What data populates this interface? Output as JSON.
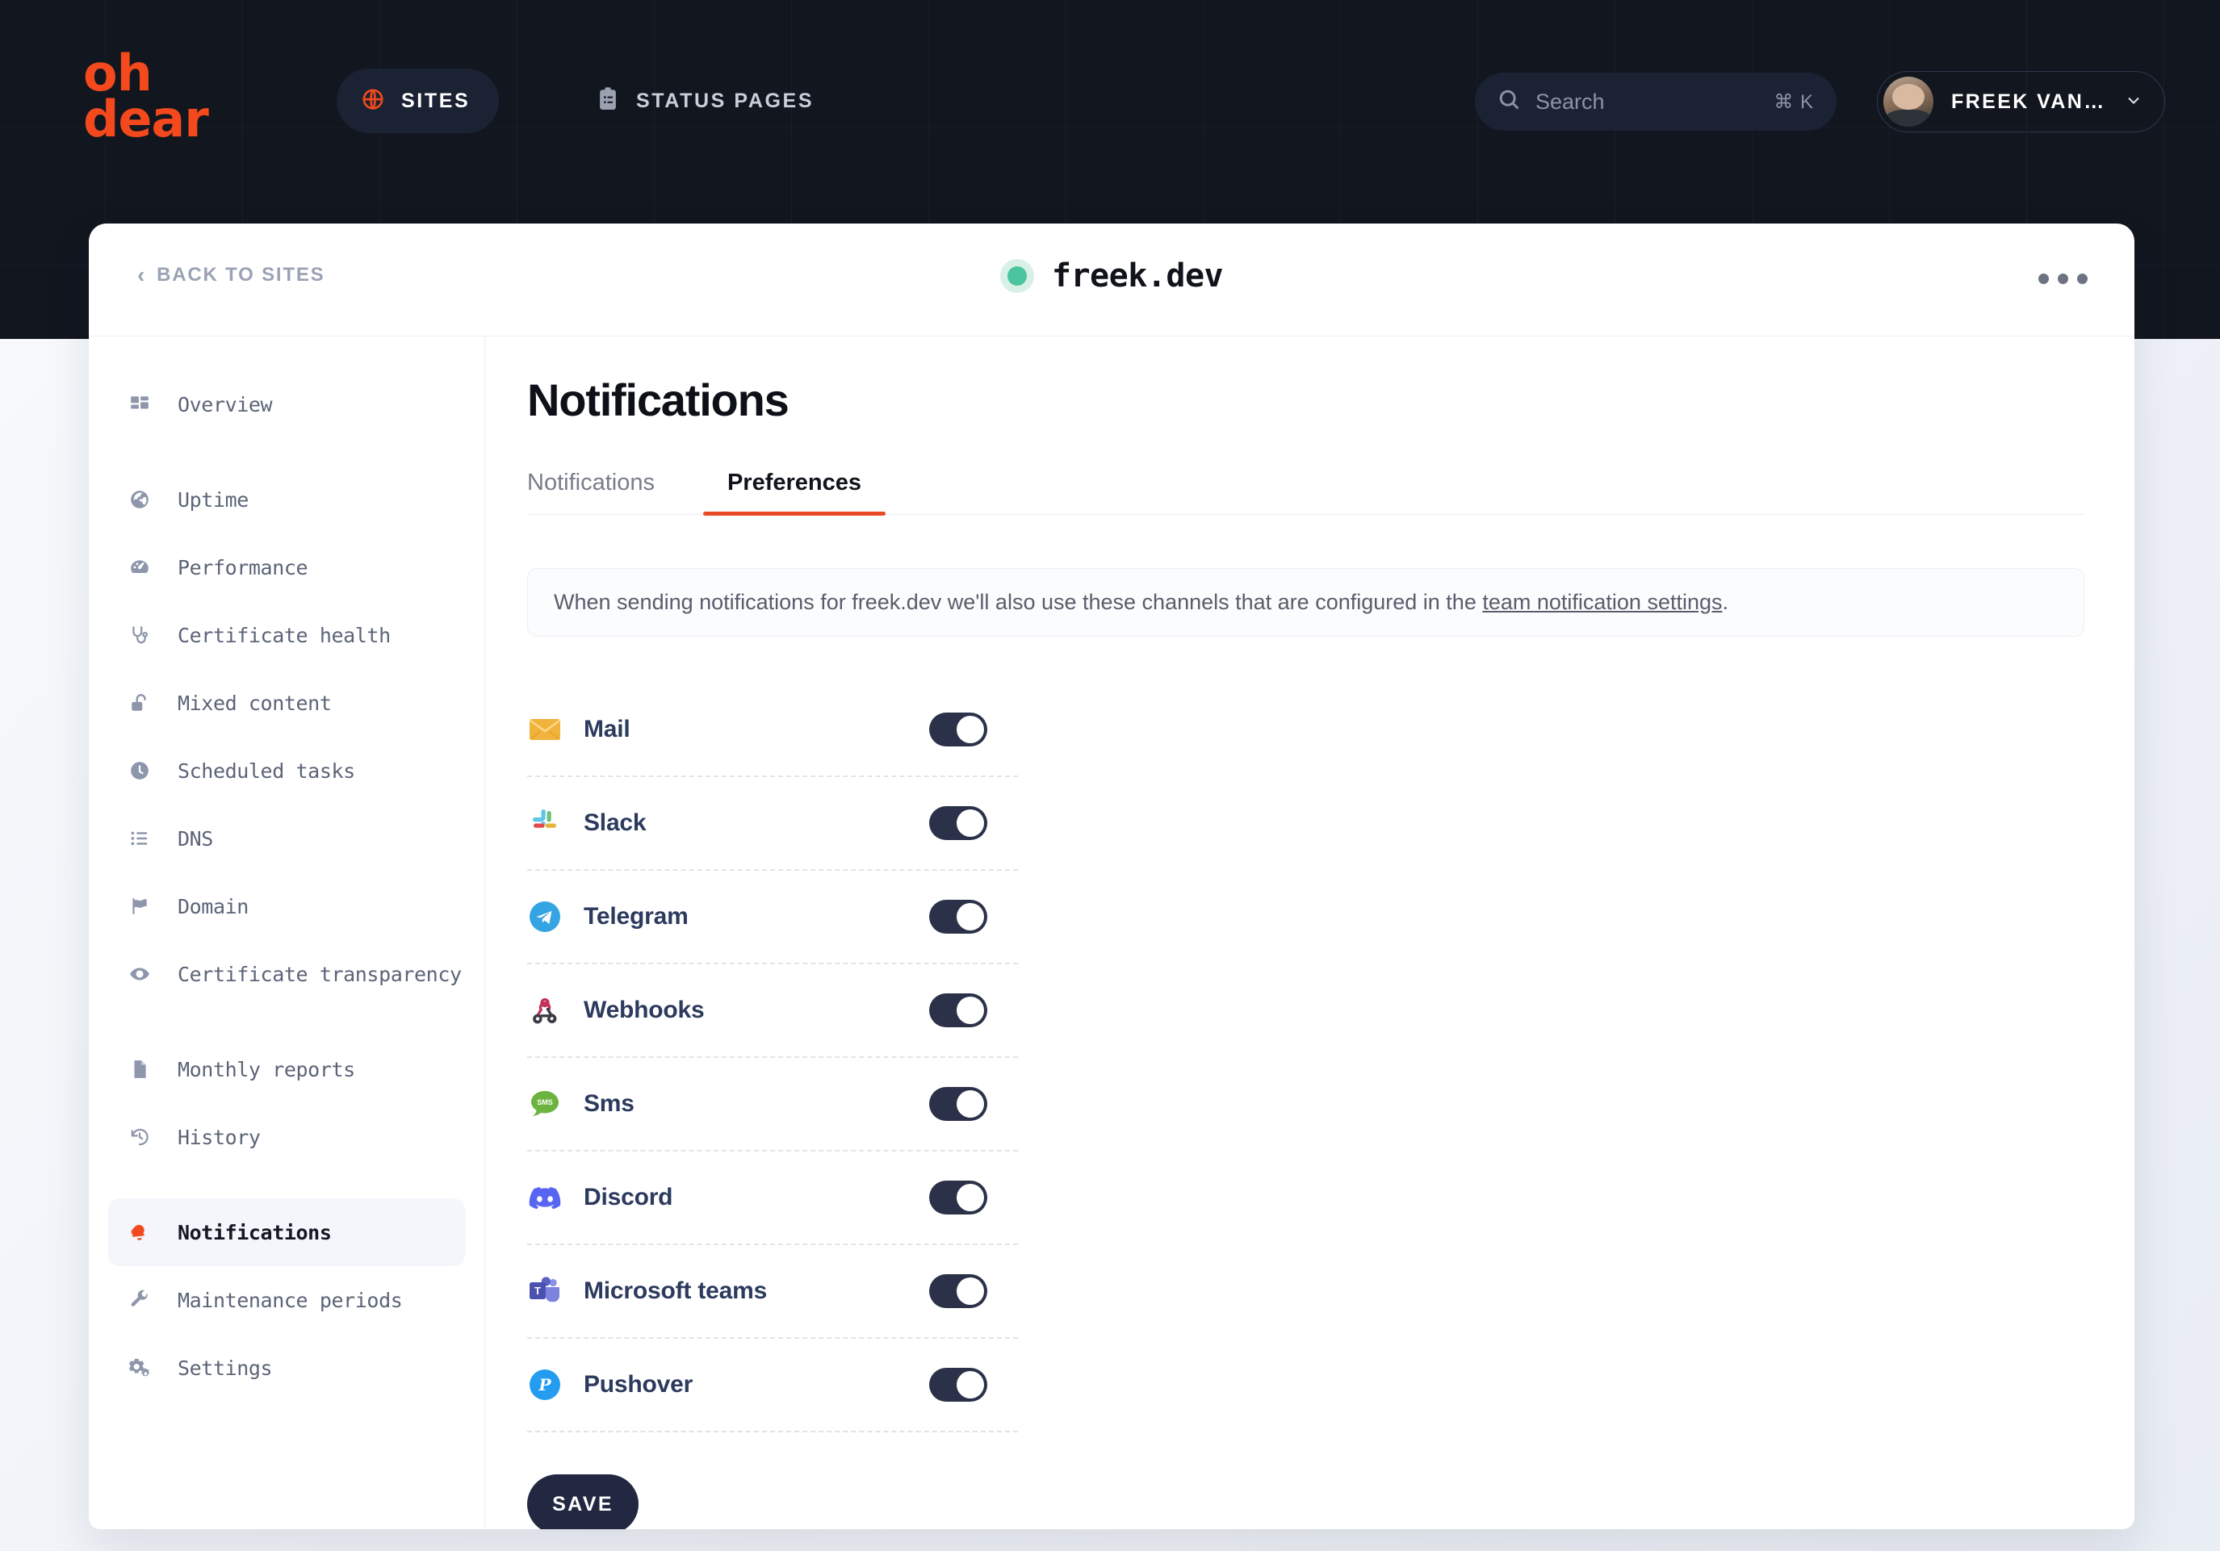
{
  "brand": {
    "logo_line1": "oh",
    "logo_line2": "dear",
    "accent_color": "#f3491d"
  },
  "header": {
    "nav": [
      {
        "label": "SITES",
        "icon": "globe-icon",
        "active": true
      },
      {
        "label": "STATUS PAGES",
        "icon": "clipboard-list-icon",
        "active": false
      }
    ],
    "search": {
      "placeholder": "Search",
      "shortcut": "⌘ K",
      "icon": "search-icon"
    },
    "user": {
      "name": "FREEK VAN…",
      "avatar": "avatar",
      "chevron": "chevron-down-icon"
    }
  },
  "card": {
    "back_link": "BACK TO SITES",
    "site_name": "freek.dev",
    "status_color": "#4cc4a0",
    "overflow_menu": "more-options-icon"
  },
  "sidebar": {
    "items": [
      {
        "label": "Overview",
        "icon": "grid-icon",
        "active": false,
        "gap_after": true
      },
      {
        "label": "Uptime",
        "icon": "globe-icon",
        "active": false
      },
      {
        "label": "Performance",
        "icon": "gauge-icon",
        "active": false
      },
      {
        "label": "Certificate health",
        "icon": "stethoscope-icon",
        "active": false
      },
      {
        "label": "Mixed content",
        "icon": "unlock-icon",
        "active": false
      },
      {
        "label": "Scheduled tasks",
        "icon": "clock-icon",
        "active": false
      },
      {
        "label": "DNS",
        "icon": "list-icon",
        "active": false
      },
      {
        "label": "Domain",
        "icon": "flag-icon",
        "active": false
      },
      {
        "label": "Certificate transparency",
        "icon": "eye-icon",
        "active": false,
        "gap_after": true
      },
      {
        "label": "Monthly reports",
        "icon": "document-icon",
        "active": false
      },
      {
        "label": "History",
        "icon": "history-icon",
        "active": false,
        "gap_after": true
      },
      {
        "label": "Notifications",
        "icon": "bell-icon",
        "active": true
      },
      {
        "label": "Maintenance periods",
        "icon": "wrench-icon",
        "active": false
      },
      {
        "label": "Settings",
        "icon": "gears-icon",
        "active": false
      }
    ]
  },
  "main": {
    "title": "Notifications",
    "tabs": [
      {
        "label": "Notifications",
        "active": false
      },
      {
        "label": "Preferences",
        "active": true
      }
    ],
    "banner": {
      "text_before": "When sending notifications for freek.dev we'll also use these channels that are configured in the ",
      "link_text": "team notification settings",
      "text_after": "."
    },
    "channels": [
      {
        "label": "Mail",
        "icon": "mail-icon",
        "enabled": true
      },
      {
        "label": "Slack",
        "icon": "slack-icon",
        "enabled": true
      },
      {
        "label": "Telegram",
        "icon": "telegram-icon",
        "enabled": true
      },
      {
        "label": "Webhooks",
        "icon": "webhook-icon",
        "enabled": true
      },
      {
        "label": "Sms",
        "icon": "sms-icon",
        "enabled": true
      },
      {
        "label": "Discord",
        "icon": "discord-icon",
        "enabled": true
      },
      {
        "label": "Microsoft teams",
        "icon": "microsoft-teams-icon",
        "enabled": true
      },
      {
        "label": "Pushover",
        "icon": "pushover-icon",
        "enabled": true
      }
    ],
    "save_label": "SAVE"
  }
}
